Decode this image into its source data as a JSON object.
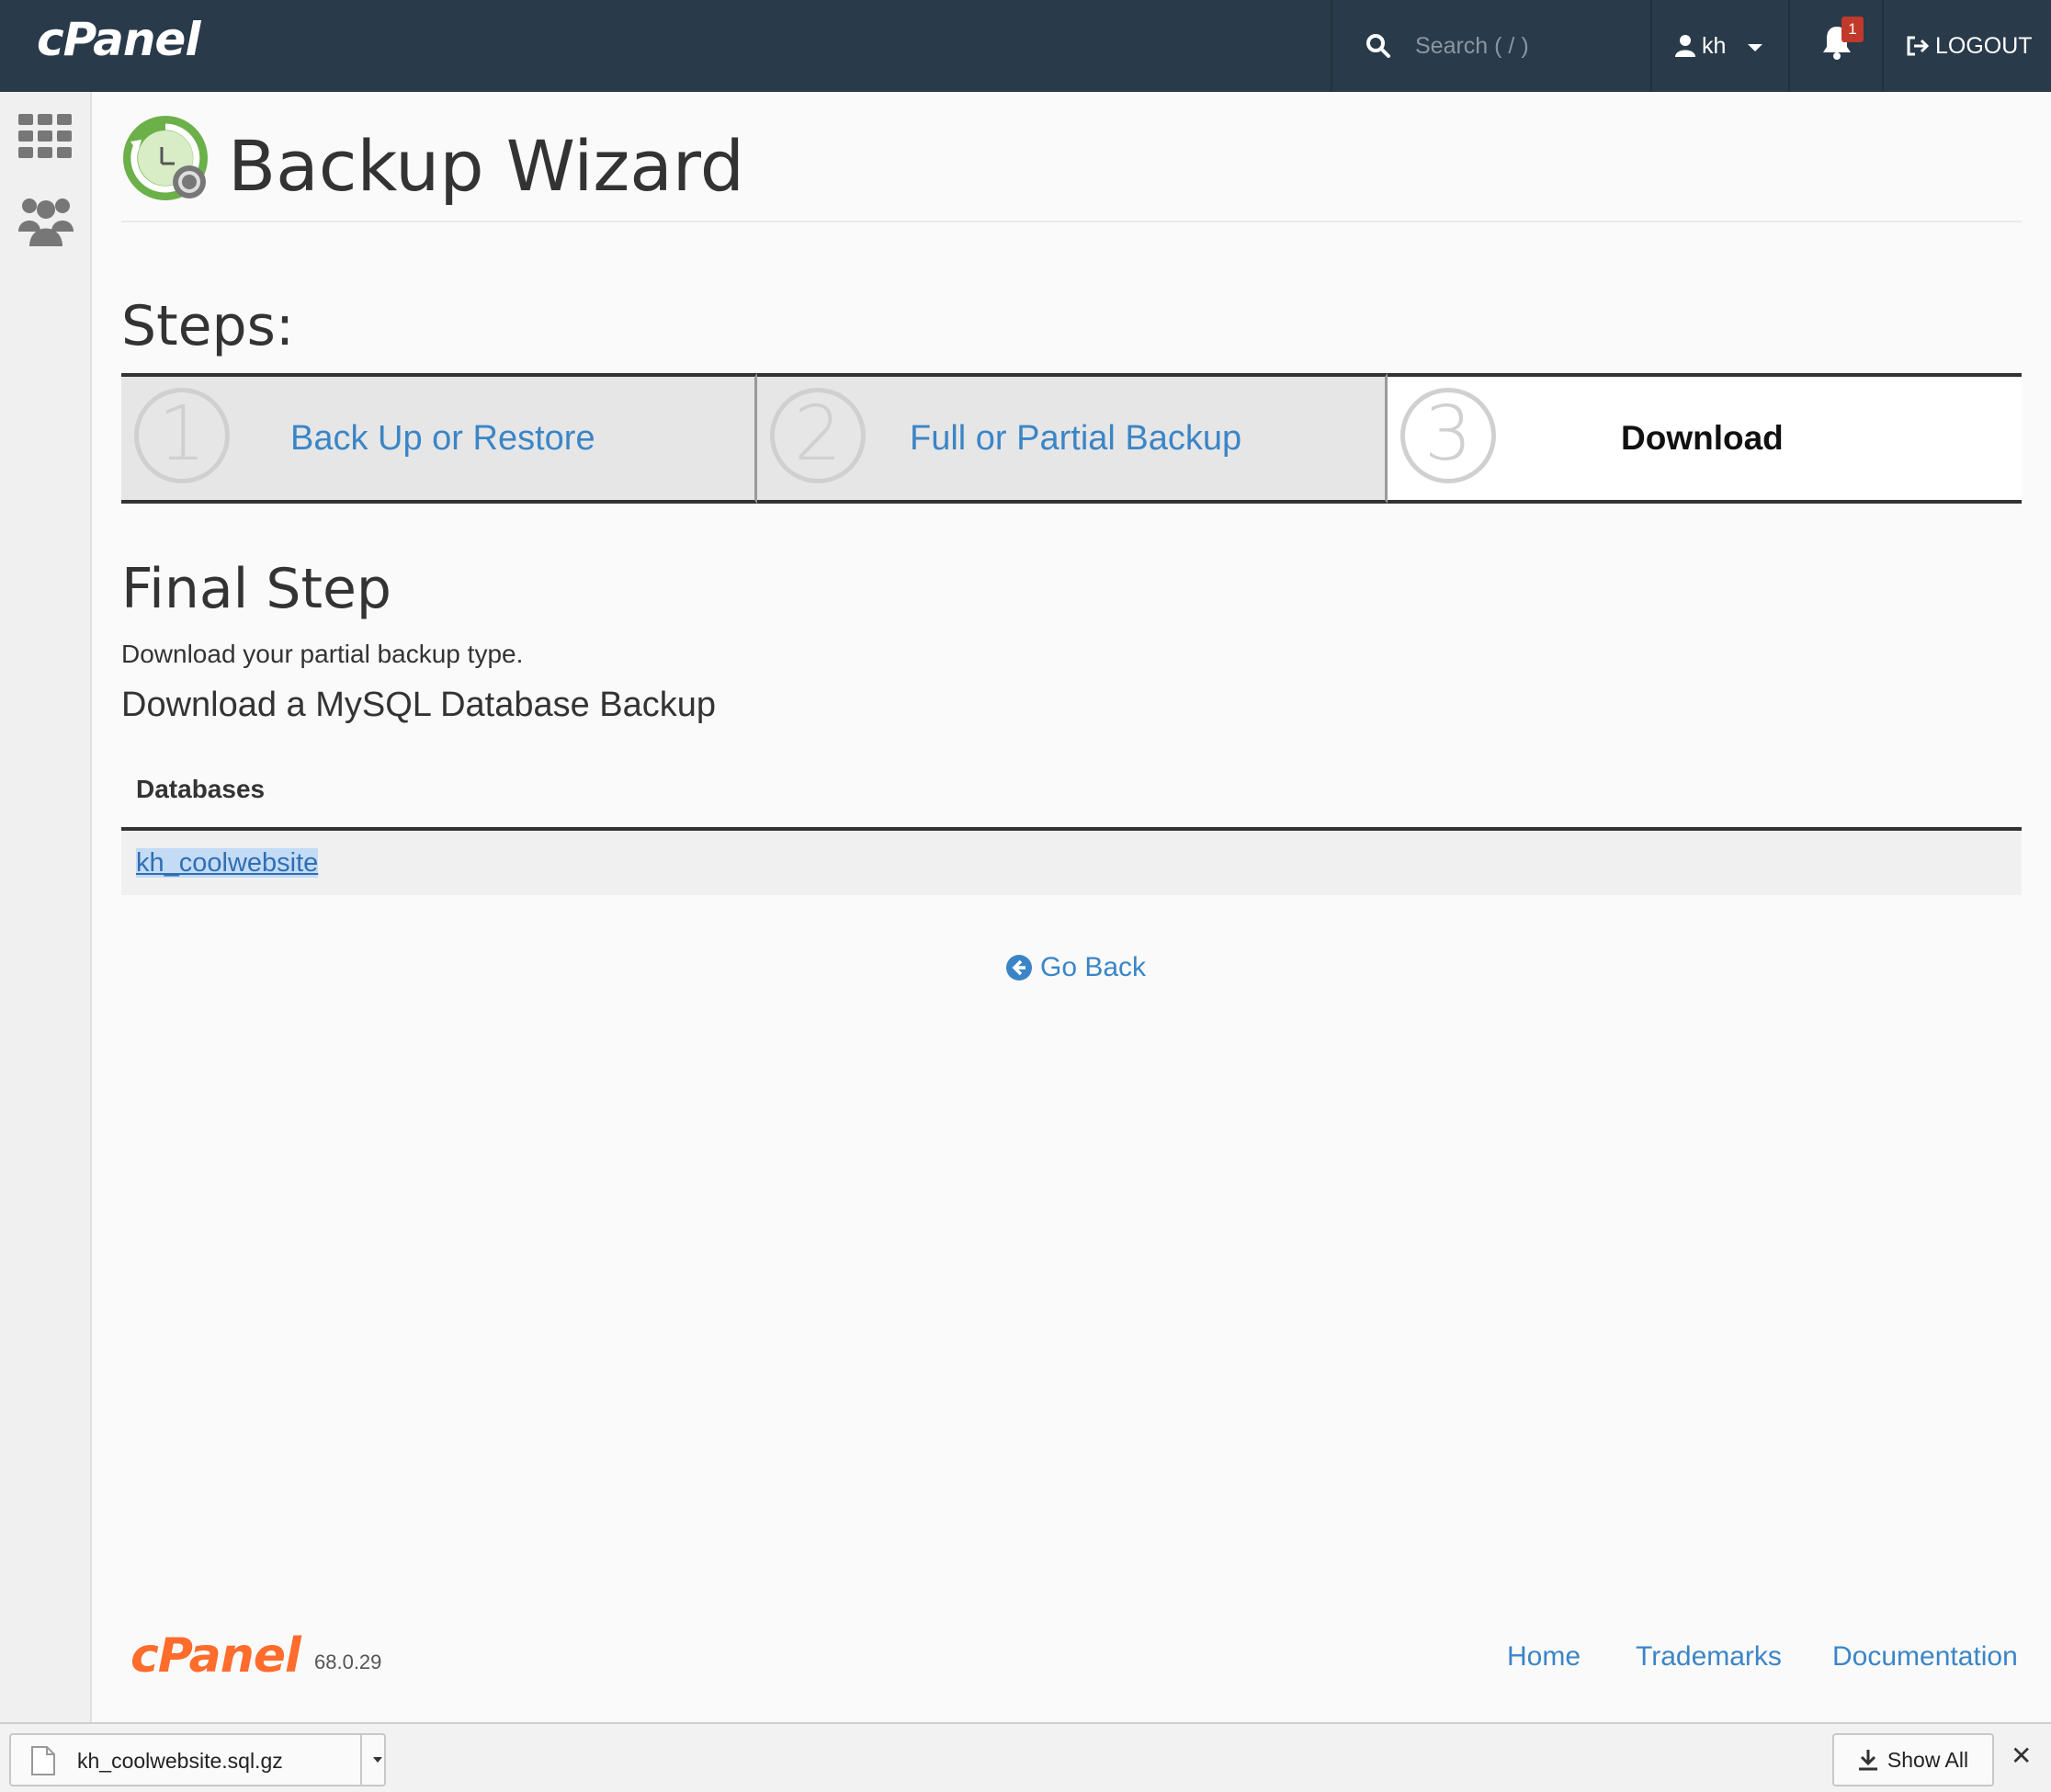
{
  "topbar": {
    "brand": "cPanel",
    "search_placeholder": "Search ( / )",
    "user": "kh",
    "notification_count": "1",
    "logout": "LOGOUT"
  },
  "page": {
    "title": "Backup Wizard",
    "steps_heading": "Steps:",
    "steps": [
      {
        "number": "1",
        "label": "Back Up or Restore"
      },
      {
        "number": "2",
        "label": "Full or Partial Backup"
      },
      {
        "number": "3",
        "label": "Download"
      }
    ],
    "final_heading": "Final Step",
    "final_description": "Download your partial backup type.",
    "subheading": "Download a MySQL Database Backup",
    "table": {
      "header": "Databases",
      "rows": [
        "kh_coolwebsite"
      ]
    },
    "go_back": "Go Back"
  },
  "footer": {
    "logo": "cPanel",
    "version": "68.0.29",
    "links": [
      "Home",
      "Trademarks",
      "Documentation"
    ]
  },
  "download_bar": {
    "file_name": "kh_coolwebsite.sql.gz",
    "show_all": "Show All",
    "close": "✕"
  },
  "colors": {
    "topbar": "#293a4a",
    "link": "#3b85c7",
    "footer_logo": "#ff6c2c",
    "badge": "#c0392b"
  }
}
